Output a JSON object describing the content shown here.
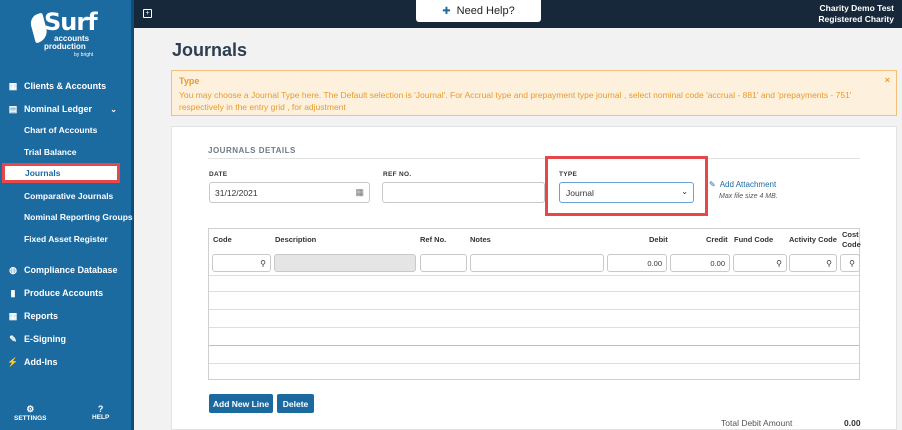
{
  "brand": {
    "name": "Surf",
    "line1": "accounts",
    "line2": "production",
    "by": "by bright"
  },
  "sidebar": {
    "items": [
      {
        "label": "Clients & Accounts",
        "icon": "grid-icon"
      },
      {
        "label": "Nominal Ledger",
        "icon": "ledger-icon"
      },
      {
        "label": "Compliance Database",
        "icon": "database-icon"
      },
      {
        "label": "Produce Accounts",
        "icon": "document-icon"
      },
      {
        "label": "Reports",
        "icon": "table-icon"
      },
      {
        "label": "E-Signing",
        "icon": "pen-icon"
      },
      {
        "label": "Add-Ins",
        "icon": "plug-icon"
      }
    ],
    "sub_items": [
      {
        "label": "Chart of Accounts"
      },
      {
        "label": "Trial Balance"
      },
      {
        "label": "Journals"
      },
      {
        "label": "Comparative Journals"
      },
      {
        "label": "Nominal Reporting Groups"
      },
      {
        "label": "Fixed Asset Register"
      }
    ],
    "settings_label": "SETTINGS",
    "help_label": "HELP"
  },
  "topbar": {
    "need_help": "Need Help?",
    "org_line1": "Charity Demo Test",
    "org_line2": "Registered Charity"
  },
  "page": {
    "title": "Journals"
  },
  "alert": {
    "title": "Type",
    "message": "You may choose a Journal Type here. The Default selection is 'Journal'. For Accrual type and prepayment type journal , select nominal code 'accrual - 881' and 'prepayments - 751' respectively in the entry grid , for adjustment",
    "close": "×"
  },
  "form": {
    "section_title": "JOURNALS DETAILS",
    "date_label": "DATE",
    "date_value": "31/12/2021",
    "ref_label": "REF NO.",
    "ref_value": "",
    "type_label": "TYPE",
    "type_value": "Journal",
    "attach_label": "Add Attachment",
    "max_size": "Max file size 4 MB."
  },
  "grid": {
    "columns": [
      "Code",
      "Description",
      "Ref No.",
      "Notes",
      "Debit",
      "Credit",
      "Fund Code",
      "Activity Code",
      "Cost",
      "Code"
    ],
    "filters": {
      "debit": "0.00",
      "credit": "0.00"
    }
  },
  "actions": {
    "add_new_line": "Add New Line",
    "delete": "Delete"
  },
  "totals": {
    "debit_label": "Total Debit Amount",
    "debit_value": "0.00"
  },
  "colors": {
    "sidebar": "#1b6aa0",
    "topbar": "#16283a",
    "highlight": "#e8474a",
    "alert_text": "#e69b2b"
  }
}
